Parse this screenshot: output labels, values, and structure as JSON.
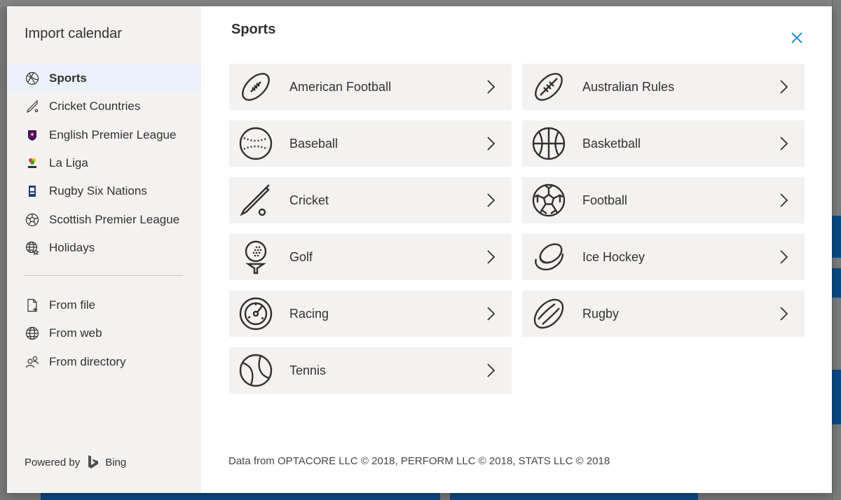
{
  "sidebar": {
    "title": "Import calendar",
    "items": [
      {
        "label": "Sports",
        "icon": "sports-icon",
        "selected": true
      },
      {
        "label": "Cricket Countries",
        "icon": "cricket-icon"
      },
      {
        "label": "English Premier League",
        "icon": "premier-league-icon"
      },
      {
        "label": "La Liga",
        "icon": "la-liga-icon"
      },
      {
        "label": "Rugby Six Nations",
        "icon": "six-nations-icon"
      },
      {
        "label": "Scottish Premier League",
        "icon": "football-icon"
      },
      {
        "label": "Holidays",
        "icon": "globe-star-icon"
      }
    ],
    "sources": [
      {
        "label": "From file",
        "icon": "file-icon"
      },
      {
        "label": "From web",
        "icon": "globe-icon"
      },
      {
        "label": "From directory",
        "icon": "people-icon"
      }
    ],
    "powered_by": "Powered by",
    "bing": "Bing"
  },
  "main": {
    "title": "Sports",
    "cards": [
      {
        "label": "American Football",
        "icon": "american-football-icon"
      },
      {
        "label": "Australian Rules",
        "icon": "australian-rules-icon"
      },
      {
        "label": "Baseball",
        "icon": "baseball-icon"
      },
      {
        "label": "Basketball",
        "icon": "basketball-icon"
      },
      {
        "label": "Cricket",
        "icon": "cricket-bat-icon"
      },
      {
        "label": "Football",
        "icon": "soccer-ball-icon"
      },
      {
        "label": "Golf",
        "icon": "golf-icon"
      },
      {
        "label": "Ice Hockey",
        "icon": "hockey-puck-icon"
      },
      {
        "label": "Racing",
        "icon": "speedometer-icon"
      },
      {
        "label": "Rugby",
        "icon": "rugby-ball-icon"
      },
      {
        "label": "Tennis",
        "icon": "tennis-ball-icon"
      }
    ],
    "footer": "Data from OPTACORE LLC © 2018, PERFORM LLC © 2018, STATS LLC © 2018"
  },
  "colors": {
    "accent": "#0078d4",
    "selected_bg": "#eaf1f9",
    "card_bg": "#f3f2f1"
  }
}
